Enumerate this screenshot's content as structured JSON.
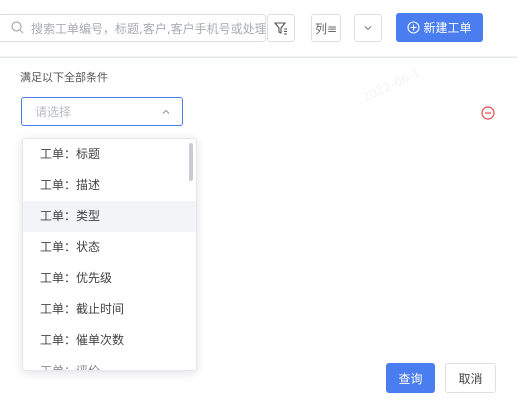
{
  "toolbar": {
    "search_placeholder": "搜索工单编号，标题,客户,客户手机号或处理",
    "columns_label": "列≡",
    "new_ticket_label": "新建工单"
  },
  "filter_panel": {
    "condition_label": "满足以下全部条件",
    "select_placeholder": "请选择",
    "options": [
      "工单：标题",
      "工单：描述",
      "工单：类型",
      "工单：状态",
      "工单：优先级",
      "工单：截止时间",
      "工单：催单次数",
      "工单：评价"
    ],
    "query_label": "查询",
    "cancel_label": "取消"
  },
  "watermark": "2022-06-1",
  "colors": {
    "primary": "#4a7df0",
    "danger": "#e5484d",
    "border": "#dcdfe6"
  }
}
